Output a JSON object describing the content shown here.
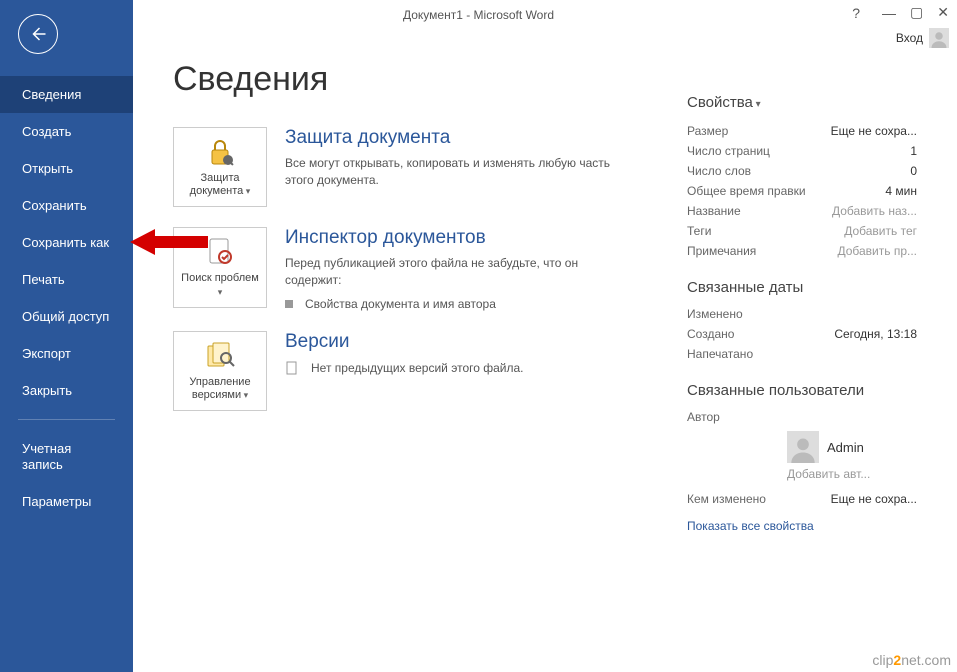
{
  "titlebar": {
    "title": "Документ1 - Microsoft Word",
    "user_label": "Вход"
  },
  "sidebar": {
    "items": [
      {
        "label": "Сведения",
        "active": true
      },
      {
        "label": "Создать"
      },
      {
        "label": "Открыть"
      },
      {
        "label": "Сохранить"
      },
      {
        "label": "Сохранить как"
      },
      {
        "label": "Печать"
      },
      {
        "label": "Общий доступ"
      },
      {
        "label": "Экспорт"
      },
      {
        "label": "Закрыть"
      }
    ],
    "bottom_items": [
      {
        "label": "Учетная запись"
      },
      {
        "label": "Параметры"
      }
    ]
  },
  "page": {
    "title": "Сведения"
  },
  "sections": {
    "protect": {
      "tile_label": "Защита документа",
      "title": "Защита документа",
      "desc": "Все могут открывать, копировать и изменять любую часть этого документа."
    },
    "inspect": {
      "tile_label": "Поиск проблем",
      "title": "Инспектор документов",
      "desc": "Перед публикацией этого файла не забудьте, что он содержит:",
      "bullet": "Свойства документа и имя автора"
    },
    "versions": {
      "tile_label": "Управление версиями",
      "title": "Версии",
      "desc": "Нет предыдущих версий этого файла."
    }
  },
  "properties": {
    "header": "Свойства",
    "rows": [
      {
        "label": "Размер",
        "value": "Еще не сохра...",
        "placeholder": false
      },
      {
        "label": "Число страниц",
        "value": "1"
      },
      {
        "label": "Число слов",
        "value": "0"
      },
      {
        "label": "Общее время правки",
        "value": "4 мин"
      },
      {
        "label": "Название",
        "value": "Добавить наз...",
        "placeholder": true
      },
      {
        "label": "Теги",
        "value": "Добавить тег",
        "placeholder": true
      },
      {
        "label": "Примечания",
        "value": "Добавить пр...",
        "placeholder": true
      }
    ],
    "dates_header": "Связанные даты",
    "dates": [
      {
        "label": "Изменено",
        "value": ""
      },
      {
        "label": "Создано",
        "value": "Сегодня, 13:18"
      },
      {
        "label": "Напечатано",
        "value": ""
      }
    ],
    "users_header": "Связанные пользователи",
    "author_label": "Автор",
    "author_name": "Admin",
    "add_author": "Добавить авт...",
    "modified_by_label": "Кем изменено",
    "modified_by_value": "Еще не сохра...",
    "show_all": "Показать все свойства"
  },
  "watermark": {
    "pre": "clip",
    "num": "2",
    "post": "net.com"
  }
}
